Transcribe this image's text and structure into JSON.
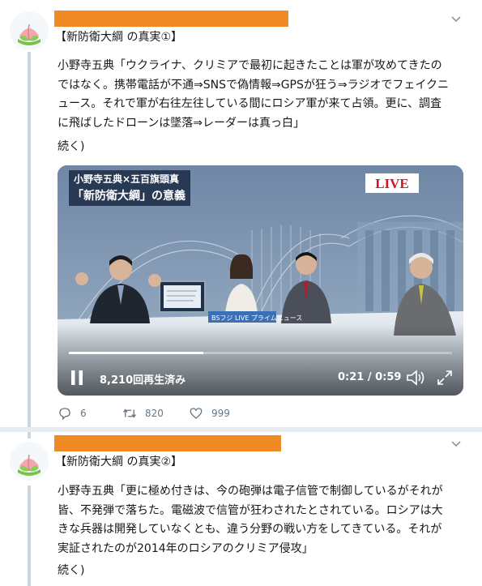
{
  "tweets": [
    {
      "title": "【新防衛大綱 の真実①】",
      "body": "小野寺五典「ウクライナ、クリミアで最初に起きたことは軍が攻めてきたのではなく。携帯電話が不通⇒SNSで偽情報⇒GPSが狂う⇒ラジオでフェイクニュース。それで軍が右往左往している間にロシア軍が来て占領。更に、調査に飛ばしたドローンは墜落⇒レーダーは真っ白」",
      "more": "続く)",
      "video": {
        "banner_line1": "小野寺五典×五百旗頭真",
        "banner_line2": "「新防衛大綱」の意義",
        "live_label": "LIVE",
        "views": "8,210回再生済み",
        "time": "0:21 / 0:59",
        "progress": 0.35,
        "desk_caption": "BSフジ LIVE プライムニュース"
      },
      "replies": "6",
      "retweets": "820",
      "likes": "999"
    },
    {
      "title": "【新防衛大綱 の真実②】",
      "body": "小野寺五典「更に極め付きは、今の砲弾は電子信管で制御しているがそれが皆、不発弾で落ちた。電磁波で信管が狂わされたとされている。ロシアは大きな兵器は開発していなくとも、違う分野の戦い方をしてきている。それが実証されたのが2014年のロシアのクリミア侵攻」",
      "more": "続く)"
    }
  ],
  "colors": {
    "redaction": "#f08a24",
    "thread_line": "#ccd6dd",
    "text_secondary": "#657786",
    "live_red": "#d8141e"
  },
  "icons": [
    "peach-avatar-icon",
    "chevron-down-icon",
    "reply-icon",
    "retweet-icon",
    "like-icon",
    "pause-icon",
    "volume-icon",
    "fullscreen-icon"
  ]
}
